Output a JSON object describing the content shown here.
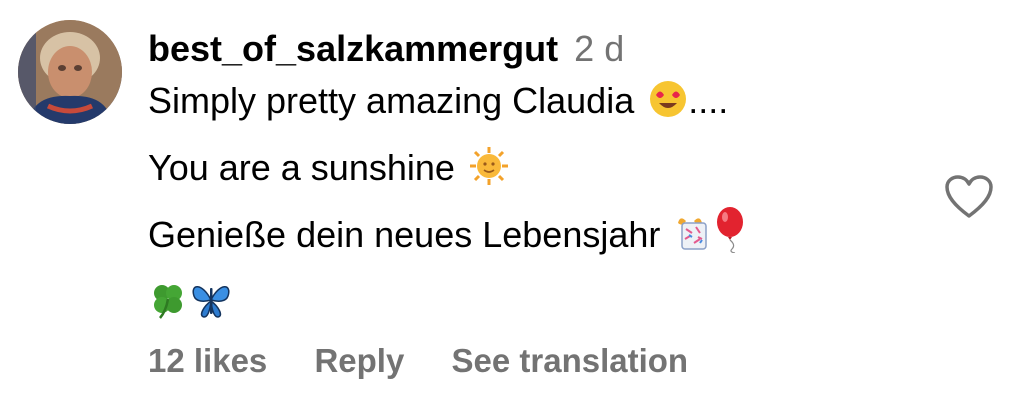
{
  "comment": {
    "username": "best_of_salzkammergut",
    "time": "2 d",
    "lines": [
      "Simply pretty amazing Claudia",
      "You are a sunshine",
      "Genieße dein neues Lebensjahr"
    ],
    "line_suffix": "....",
    "icons": [
      "heart-eyes-emoji",
      "sun-face-emoji",
      "confetti-gift-emoji",
      "balloon-emoji",
      "four-leaf-clover-emoji",
      "butterfly-emoji",
      "heart-icon"
    ]
  },
  "footer": {
    "likes": "12 likes",
    "reply": "Reply",
    "translation": "See translation"
  },
  "colors": {
    "text": "#000000",
    "muted": "#737373",
    "heart_outline": "#737373"
  }
}
